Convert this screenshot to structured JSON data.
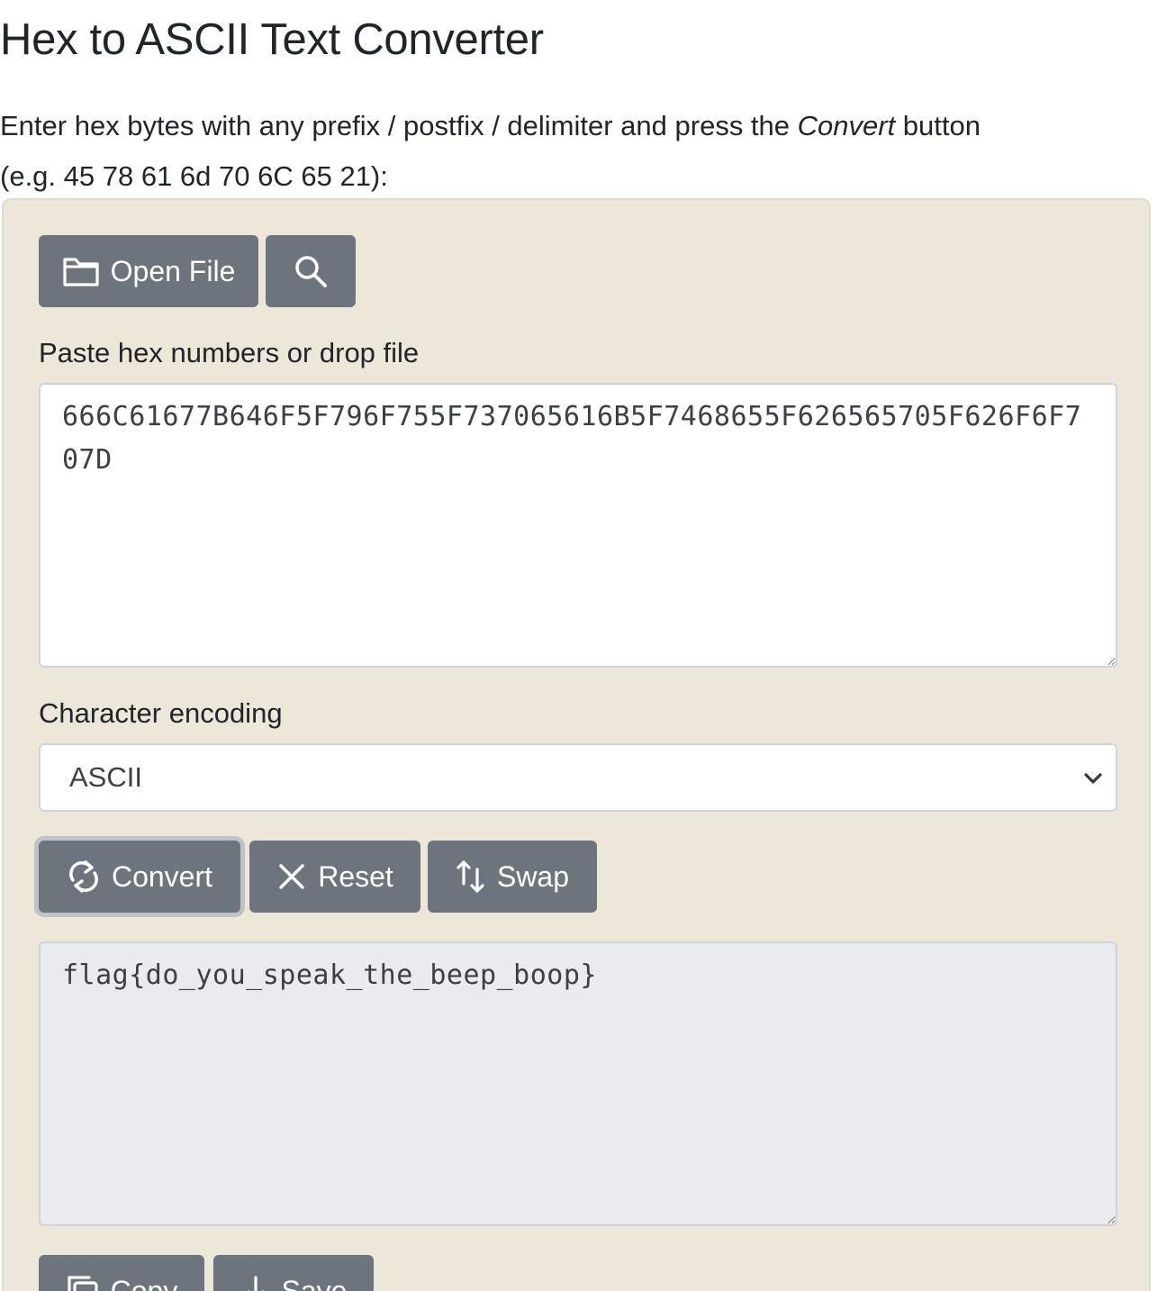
{
  "page": {
    "title": "Hex to ASCII Text Converter",
    "intro_line1_before": "Enter hex bytes with any prefix / postfix / delimiter and press the ",
    "intro_line1_em": "Convert",
    "intro_line1_after": " button",
    "intro_line2": "(e.g. 45 78 61 6d 70 6C 65 21):"
  },
  "file_toolbar": {
    "open_label": "Open File"
  },
  "input": {
    "label": "Paste hex numbers or drop file",
    "value": "666C61677B646F5F796F755F737065616B5F7468655F626565705F626F6F707D"
  },
  "encoding": {
    "label": "Character encoding",
    "selected": "ASCII"
  },
  "actions": {
    "convert_label": "Convert",
    "reset_label": "Reset",
    "swap_label": "Swap"
  },
  "output": {
    "value": "flag{do_you_speak_the_beep_boop}"
  },
  "output_toolbar": {
    "copy_label": "Copy",
    "save_label": "Save"
  },
  "colors": {
    "button_bg": "#6c757d",
    "panel_bg": "#ede7d9",
    "output_bg": "#e9ebef"
  },
  "icons": [
    "folder-icon",
    "search-icon",
    "refresh-icon",
    "close-icon",
    "swap-icon",
    "copy-icon",
    "download-icon",
    "chevron-down-icon"
  ]
}
